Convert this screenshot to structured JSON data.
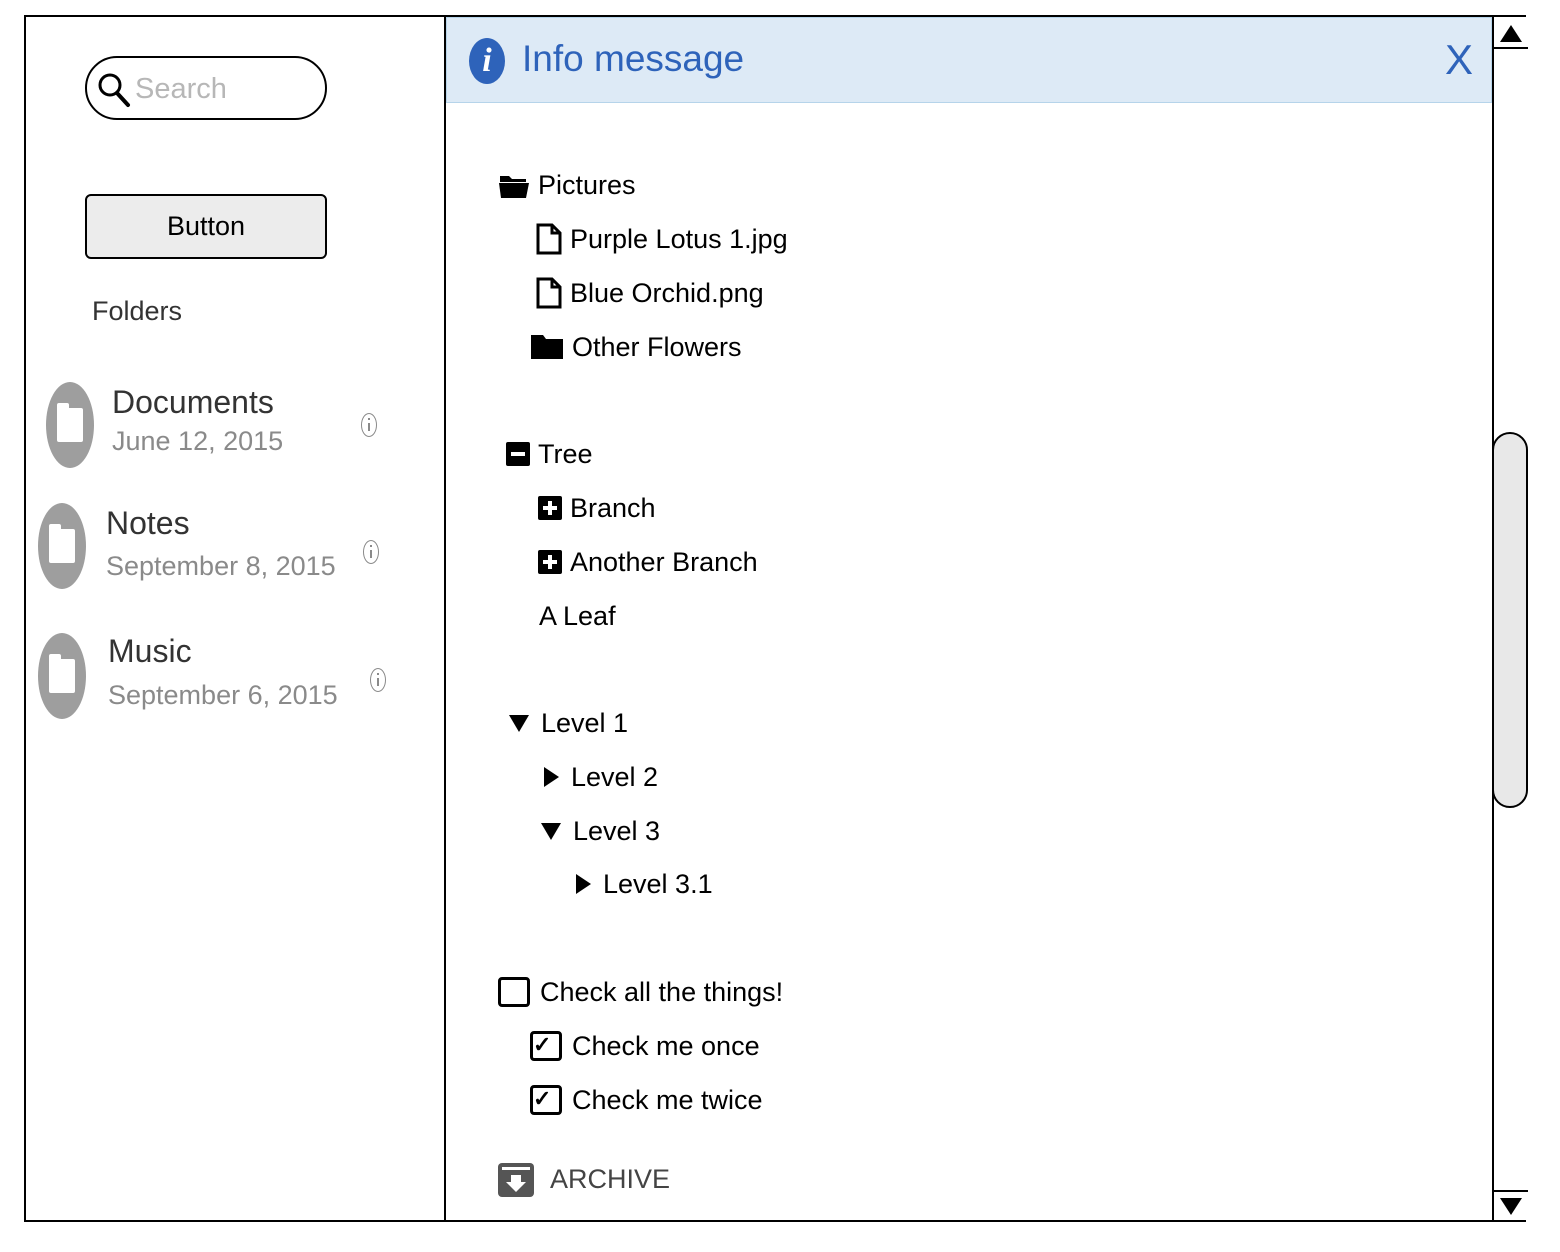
{
  "sidebar": {
    "search_placeholder": "Search",
    "button_label": "Button",
    "folders_label": "Folders",
    "folders": [
      {
        "title": "Documents",
        "date": "June 12, 2015",
        "icon": "folder-icon"
      },
      {
        "title": "Notes",
        "date": "September 8, 2015",
        "icon": "folder-icon"
      },
      {
        "title": "Music",
        "date": "September 6, 2015",
        "icon": "folder-icon"
      }
    ]
  },
  "info_bar": {
    "icon_letter": "i",
    "title": "Info message",
    "close_label": "X",
    "color": "#2e63ba",
    "background": "#ddeaf6"
  },
  "file_tree": {
    "root": {
      "label": "Pictures",
      "icon": "folder-open-icon"
    },
    "children": [
      {
        "label": "Purple Lotus 1.jpg",
        "icon": "file-icon"
      },
      {
        "label": "Blue Orchid.png",
        "icon": "file-icon"
      },
      {
        "label": "Other Flowers",
        "icon": "folder-icon"
      }
    ]
  },
  "plus_tree": {
    "root": {
      "label": "Tree",
      "icon": "minus-box-icon"
    },
    "children": [
      {
        "label": "Branch",
        "icon": "plus-box-icon"
      },
      {
        "label": "Another Branch",
        "icon": "plus-box-icon"
      },
      {
        "label": "A Leaf",
        "icon": ""
      }
    ]
  },
  "level_tree": {
    "items": [
      {
        "label": "Level 1",
        "expanded": true
      },
      {
        "label": "Level 2",
        "expanded": false
      },
      {
        "label": "Level 3",
        "expanded": true
      },
      {
        "label": "Level 3.1",
        "expanded": false
      }
    ]
  },
  "check_tree": {
    "root": {
      "label": "Check all the things!",
      "checked": false
    },
    "children": [
      {
        "label": "Check me once",
        "checked": true
      },
      {
        "label": "Check me twice",
        "checked": true
      }
    ],
    "check_glyph": "✓"
  },
  "archive": {
    "label": "ARCHIVE",
    "icon": "archive-download-icon"
  }
}
